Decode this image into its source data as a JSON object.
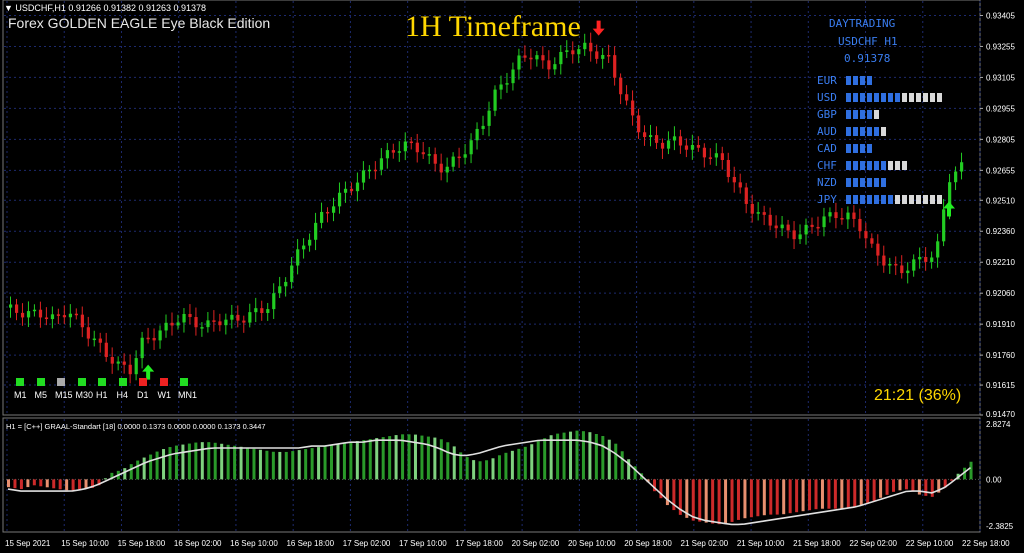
{
  "header": {
    "symbol_line": "▼ USDCHF,H1  0.91266 0.91382 0.91263 0.91378",
    "indicator_title": "Forex GOLDEN EAGLE Eye Black Edition",
    "big_title": "1H Timeframe"
  },
  "dashboard": {
    "title": "DAYTRADING",
    "symbol": "USDCHF H1",
    "price": "0.91378",
    "currencies": [
      {
        "name": "EUR",
        "blue": 4,
        "white": 0
      },
      {
        "name": "USD",
        "blue": 8,
        "white": 6
      },
      {
        "name": "GBP",
        "blue": 4,
        "white": 1
      },
      {
        "name": "AUD",
        "blue": 5,
        "white": 1
      },
      {
        "name": "CAD",
        "blue": 4,
        "white": 0
      },
      {
        "name": "CHF",
        "blue": 6,
        "white": 3
      },
      {
        "name": "NZD",
        "blue": 6,
        "white": 0
      },
      {
        "name": "JPY",
        "blue": 7,
        "white": 7
      }
    ],
    "bar_colors": {
      "blue": "#2f6fe0",
      "white": "#d8d8d8"
    }
  },
  "timeframes": [
    {
      "label": "M1",
      "color": "#22dd22"
    },
    {
      "label": "M5",
      "color": "#22dd22"
    },
    {
      "label": "M15",
      "color": "#aaaaaa"
    },
    {
      "label": "M30",
      "color": "#22dd22"
    },
    {
      "label": "H1",
      "color": "#22dd22"
    },
    {
      "label": "H4",
      "color": "#22dd22"
    },
    {
      "label": "D1",
      "color": "#ee2222"
    },
    {
      "label": "W1",
      "color": "#ee2222"
    },
    {
      "label": "MN1",
      "color": "#22dd22"
    }
  ],
  "status_text": "21:21 (36%)",
  "indicator_caption": "H1 = [C++] GRAAL-Standart [18] 0.0000 0.1373 0.0000 0.0000 0.1373 0.3447",
  "chart_data": {
    "type": "candlestick",
    "price_ticks": [
      "0.93405",
      "0.93255",
      "0.93105",
      "0.92955",
      "0.92805",
      "0.92655",
      "0.92510",
      "0.92360",
      "0.92210",
      "0.92060",
      "0.91910",
      "0.91760",
      "0.91615",
      "0.91470"
    ],
    "ylim": [
      0.9147,
      0.9348
    ],
    "indicator_ticks": [
      "2.8274",
      "0.00",
      "-2.3825"
    ],
    "indicator_ylim": [
      -2.3825,
      2.8274
    ],
    "time_labels": [
      "15 Sep 2021",
      "15 Sep 10:00",
      "15 Sep 18:00",
      "16 Sep 02:00",
      "16 Sep 10:00",
      "16 Sep 18:00",
      "17 Sep 02:00",
      "17 Sep 10:00",
      "17 Sep 18:00",
      "20 Sep 02:00",
      "20 Sep 10:00",
      "20 Sep 18:00",
      "21 Sep 02:00",
      "21 Sep 10:00",
      "21 Sep 18:00",
      "22 Sep 02:00",
      "22 Sep 10:00",
      "22 Sep 18:00"
    ],
    "path_points": [
      0.9199,
      0.9197,
      0.9196,
      0.9196,
      0.9193,
      0.9198,
      0.9191,
      0.9184,
      0.9177,
      0.9171,
      0.9169,
      0.9183,
      0.9186,
      0.919,
      0.9195,
      0.9192,
      0.919,
      0.9193,
      0.9193,
      0.9194,
      0.9197,
      0.92,
      0.921,
      0.9222,
      0.9232,
      0.9242,
      0.9249,
      0.9255,
      0.926,
      0.9266,
      0.9271,
      0.9276,
      0.9278,
      0.9276,
      0.9269,
      0.9266,
      0.9272,
      0.9278,
      0.9289,
      0.9303,
      0.9311,
      0.932,
      0.9322,
      0.9315,
      0.932,
      0.9324,
      0.9325,
      0.9322,
      0.9319,
      0.9303,
      0.9289,
      0.9281,
      0.9278,
      0.928,
      0.9278,
      0.9275,
      0.9273,
      0.927,
      0.9259,
      0.9249,
      0.9243,
      0.924,
      0.9236,
      0.9234,
      0.9238,
      0.9242,
      0.9244,
      0.9243,
      0.9238,
      0.9226,
      0.9221,
      0.9216,
      0.922,
      0.9223,
      0.9225,
      0.9262,
      0.9267
    ],
    "buy_arrows_at": [
      11,
      75
    ],
    "sell_arrows_at": [
      47
    ],
    "histogram": [
      -0.4,
      -0.5,
      -0.3,
      -0.4,
      -0.5,
      -0.6,
      -0.5,
      -0.4,
      0.3,
      0.5,
      0.9,
      1.2,
      1.5,
      1.7,
      1.8,
      1.9,
      1.9,
      1.8,
      1.7,
      1.6,
      1.5,
      1.4,
      1.4,
      1.5,
      1.6,
      1.7,
      1.8,
      1.9,
      2.0,
      2.1,
      2.2,
      2.3,
      2.3,
      2.2,
      2.1,
      1.8,
      1.2,
      0.9,
      1.0,
      1.3,
      1.5,
      1.7,
      2.0,
      2.3,
      2.4,
      2.5,
      2.4,
      2.2,
      1.8,
      1.0,
      0.3,
      -0.6,
      -1.3,
      -1.8,
      -2.1,
      -2.2,
      -2.3,
      -2.2,
      -2.0,
      -1.9,
      -1.8,
      -1.8,
      -1.7,
      -1.6,
      -1.5,
      -1.5,
      -1.5,
      -1.4,
      -1.2,
      -0.9,
      -0.6,
      -0.5,
      -0.8,
      -0.9,
      -0.4,
      0.3,
      0.9
    ],
    "signal_line": [
      -0.5,
      -0.6,
      -0.6,
      -0.6,
      -0.6,
      -0.6,
      -0.5,
      -0.3,
      0.0,
      0.3,
      0.6,
      0.9,
      1.1,
      1.3,
      1.4,
      1.5,
      1.6,
      1.6,
      1.6,
      1.6,
      1.6,
      1.6,
      1.6,
      1.6,
      1.7,
      1.7,
      1.8,
      1.9,
      1.9,
      2.0,
      2.0,
      2.0,
      1.9,
      1.8,
      1.6,
      1.3,
      1.2,
      1.3,
      1.5,
      1.7,
      1.8,
      1.9,
      2.0,
      2.0,
      2.0,
      2.0,
      1.9,
      1.7,
      1.3,
      0.8,
      0.2,
      -0.4,
      -1.0,
      -1.5,
      -1.9,
      -2.1,
      -2.2,
      -2.3,
      -2.3,
      -2.2,
      -2.1,
      -2.0,
      -1.9,
      -1.8,
      -1.7,
      -1.6,
      -1.5,
      -1.4,
      -1.2,
      -1.0,
      -0.8,
      -0.6,
      -0.6,
      -0.7,
      -0.4,
      0.1,
      0.6
    ],
    "colors": {
      "bull": "#22cc22",
      "bear": "#dd2222",
      "hist_pos": "#2a9a2a",
      "hist_neg": "#cc2a2a",
      "line": "#e0e0e0",
      "grid": "#1d2a6e"
    }
  }
}
